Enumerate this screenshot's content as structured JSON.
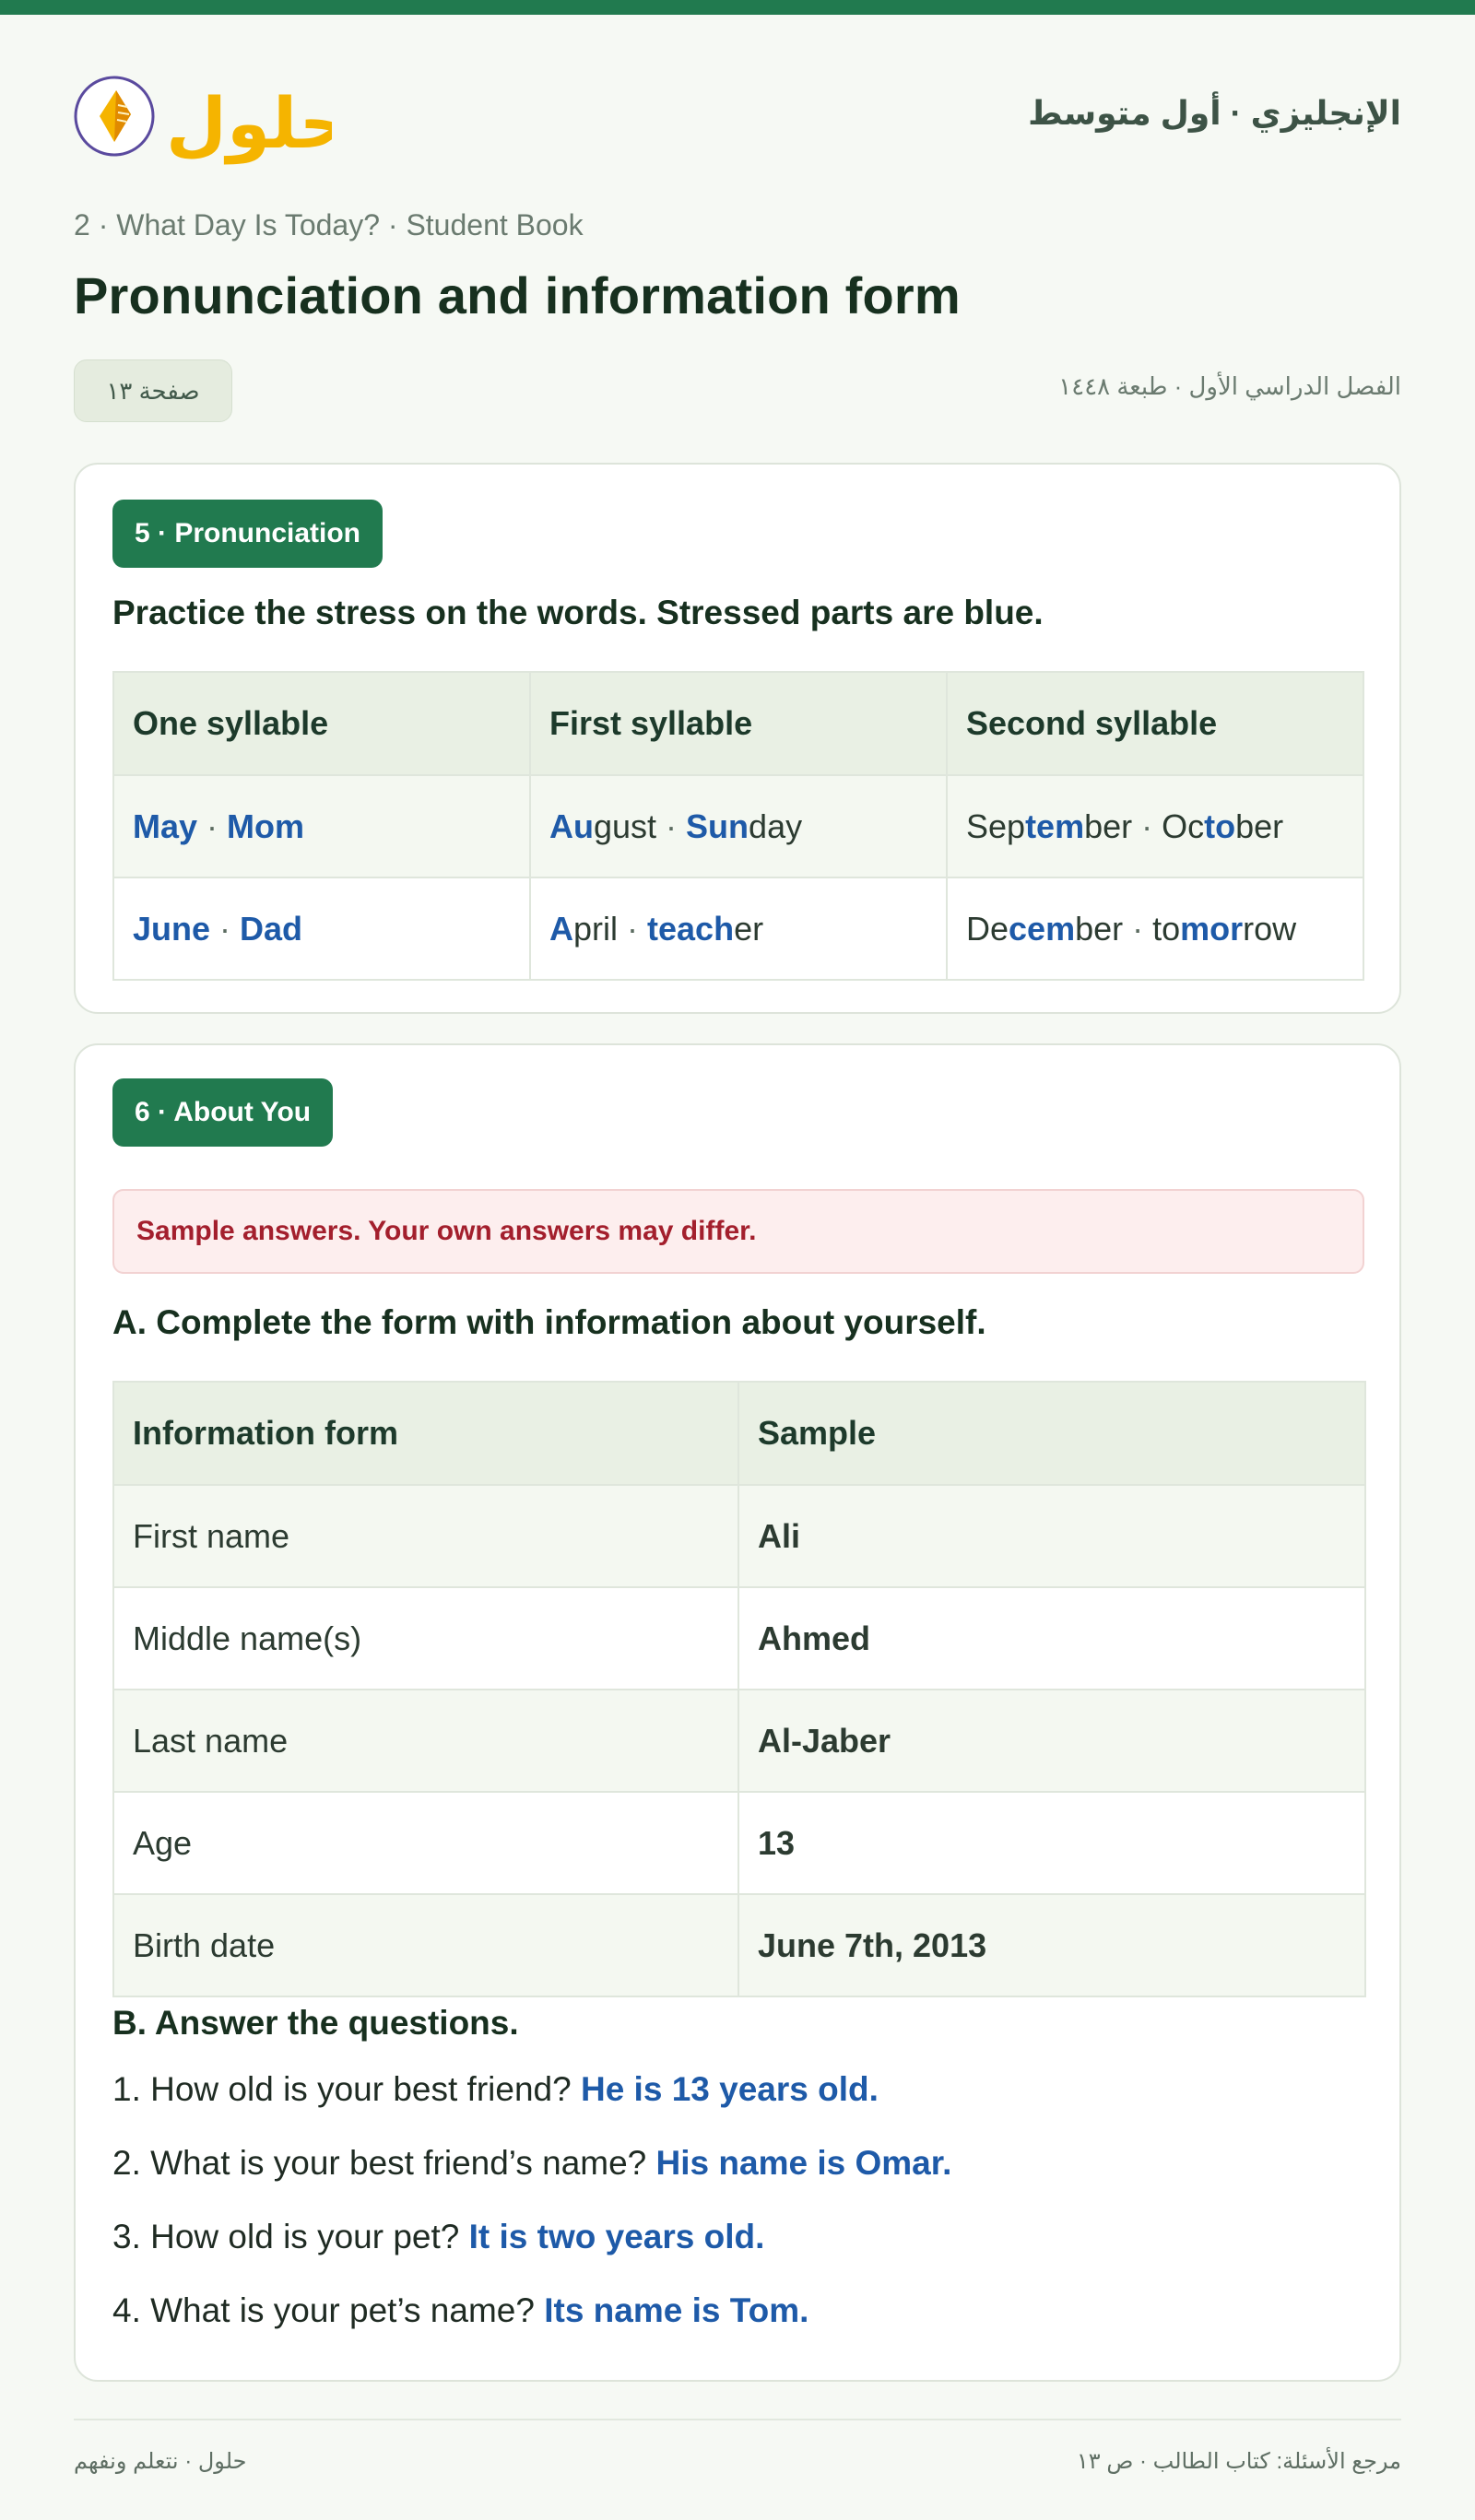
{
  "brand": {
    "logo_text": "حلول",
    "subject": "الإنجليزي · أول متوسط",
    "colors": {
      "accent": "#217a4f",
      "answer_blue": "#1e5aa8",
      "notice_red": "#a31f2d",
      "logo_gold": "#f5b400"
    }
  },
  "breadcrumb": "2 · What Day Is Today? · Student Book",
  "page_title": "Pronunciation and information form",
  "page_badge": "صفحة ١٣",
  "term_info": "الفصل الدراسي الأول · طبعة ١٤٤٨",
  "pronunciation": {
    "section_label": "5 · Pronunciation",
    "instruction": "Practice the stress on the words. Stressed parts are blue.",
    "headers": [
      "One syllable",
      "First syllable",
      "Second syllable"
    ],
    "rows": [
      [
        [
          {
            "t": "May",
            "s": true
          },
          {
            "t": " · ",
            "sep": true
          },
          {
            "t": "Mom",
            "s": true
          }
        ],
        [
          {
            "t": "Au",
            "s": true
          },
          {
            "t": "gust"
          },
          {
            "t": " · ",
            "sep": true
          },
          {
            "t": "Sun",
            "s": true
          },
          {
            "t": "day"
          }
        ],
        [
          {
            "t": "Sep"
          },
          {
            "t": "tem",
            "s": true
          },
          {
            "t": "ber"
          },
          {
            "t": " · ",
            "sep": true
          },
          {
            "t": "Oc"
          },
          {
            "t": "to",
            "s": true
          },
          {
            "t": "ber"
          }
        ]
      ],
      [
        [
          {
            "t": "June",
            "s": true
          },
          {
            "t": " · ",
            "sep": true
          },
          {
            "t": "Dad",
            "s": true
          }
        ],
        [
          {
            "t": "A",
            "s": true
          },
          {
            "t": "pril"
          },
          {
            "t": " · ",
            "sep": true
          },
          {
            "t": "teach",
            "s": true
          },
          {
            "t": "er"
          }
        ],
        [
          {
            "t": "De"
          },
          {
            "t": "cem",
            "s": true
          },
          {
            "t": "ber"
          },
          {
            "t": " · ",
            "sep": true
          },
          {
            "t": "to"
          },
          {
            "t": "mor",
            "s": true
          },
          {
            "t": "row"
          }
        ]
      ]
    ]
  },
  "about": {
    "section_label": "6 · About You",
    "notice": "Sample answers. Your own answers may differ.",
    "part_a": "A. Complete the form with information about yourself.",
    "form_headers": [
      "Information form",
      "Sample"
    ],
    "form_rows": [
      {
        "field": "First name",
        "value": "Ali"
      },
      {
        "field": "Middle name(s)",
        "value": "Ahmed"
      },
      {
        "field": "Last name",
        "value": "Al-Jaber"
      },
      {
        "field": "Age",
        "value": "13"
      },
      {
        "field": "Birth date",
        "value": "June 7th, 2013"
      }
    ],
    "part_b": "B. Answer the questions.",
    "questions": [
      {
        "q": "1. How old is your best friend?",
        "a": "He is 13 years old."
      },
      {
        "q": "2. What is your best friend’s name?",
        "a": "His name is Omar."
      },
      {
        "q": "3. How old is your pet?",
        "a": "It is two years old."
      },
      {
        "q": "4. What is your pet’s name?",
        "a": "Its name is Tom."
      }
    ]
  },
  "footer": {
    "left": "حلول · نتعلم ونفهم",
    "right": "مرجع الأسئلة: كتاب الطالب · ص ١٣"
  }
}
